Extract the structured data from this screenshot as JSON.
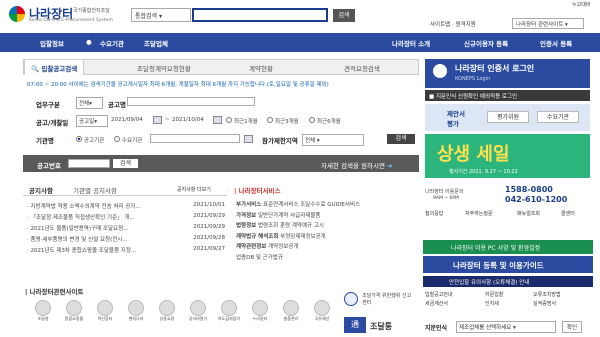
{
  "header": {
    "logo_title": "나라장터",
    "logo_sub1": "국가종합전자조달",
    "logo_sub2": "Korea ON-line E-Procurement System",
    "search_scope": "통합검색",
    "search_button": "검색",
    "top_link": "누고대비",
    "sitemap": "사이트맵 · 원격지원",
    "site_select": "나라장터 관련사이트"
  },
  "nav": {
    "items": [
      "입찰정보",
      "수요기관",
      "조달업체"
    ],
    "right_items": [
      "나라장터 소개",
      "신규이용자 등록",
      "인증서 등록"
    ]
  },
  "tabs": [
    "입찰공고검색",
    "조달청계약요청현황",
    "계약현황",
    "견적요청검색"
  ],
  "search_form": {
    "note": "07:00 ~ 20:00 사이에는 검색기간을 공고게시일자 최대 6개월, 개찰일자 최대 6개월 까지 가능합니다.(토,일요일 및 공휴일 제외)",
    "work_label": "업무구분",
    "work_value": "전체",
    "notice_name_label": "공고명",
    "period_label": "공고/개찰일",
    "period_type": "공고일",
    "date_from": "2021/09/04",
    "date_to": "2021/10/04",
    "range_opts": [
      "최근1개월",
      "최근3개월",
      "최근6개월"
    ],
    "agency_label": "기관명",
    "agency_opts": [
      "공고기관",
      "수요기관"
    ],
    "region_label": "참가제한지역",
    "region_value": "전체",
    "search_btn": "검색",
    "notice_no_label": "공고번호",
    "notice_search_btn": "검색",
    "detail_link": "자세한 검색을 원하시면"
  },
  "news": {
    "tabs": [
      "공지사항",
      "기관별 공지사항"
    ],
    "more": "공지사항 더보기",
    "items": [
      {
        "title": "· 지방계약법 적용 소액수의계약 전송 처리 공지...",
        "date": "2021/10/01"
      },
      {
        "title": "· 「조달청 제조물품 직접생산확인 기준」 개...",
        "date": "2021/09/29"
      },
      {
        "title": "· 2021년도 물품(일반용역)구매 조달요청...",
        "date": "2021/09/29"
      },
      {
        "title": "· 품명·세부품명의 변경 및 신설 요청(전시...",
        "date": "2021/09/28"
      },
      {
        "title": "· 2021년도 제3차 종합쇼핑몰 조달물품 지정...",
        "date": "2021/09/27"
      }
    ]
  },
  "services": {
    "title": "나라장터서비스",
    "rows": [
      [
        "부가서비스",
        "표준연계서비스 조달수수료 GUIDE서비스"
      ],
      [
        "가격정보",
        "일반단가계약 사급자재물품"
      ],
      [
        "법령정보",
        "법령조회 훈령 계약예규 고시"
      ],
      [
        "계약법규 해석조회",
        "부정당제재정보공개"
      ],
      [
        "계약관련정보",
        "계약정보공개"
      ],
      [
        "업종DB 및 근거법규",
        "업종DB 및 근거법규"
      ]
    ]
  },
  "related": {
    "title": "나라장터관련사이트",
    "icons": [
      "조달청",
      "종합쇼핑몰",
      "혁신장터",
      "벤처나라",
      "상용쇼핑",
      "공사비원가",
      "하도급지킴이",
      "누리장터",
      "물품관리",
      "국유재산"
    ]
  },
  "right": {
    "login_title": "나라장터 인증서 로그인",
    "login_sub": "KONEPS Login",
    "fingerprint": "지문인식 신원확인 예외적용 로그인",
    "proposal": "제안서 평가",
    "eval": "평가위원",
    "demand": "수요기관",
    "banner_title": "상생 세일",
    "banner_dates": "행사기간 2021. 9.27 ~ 10.22",
    "callcenter_label": "나라장터 이용문의",
    "call_hours": "9AM ~ 6PM",
    "phone1": "1588-0800",
    "phone2": "042-610-1200",
    "help_links": [
      "질의응답",
      "자주하는질문",
      "매뉴얼조회",
      "콜센터"
    ],
    "pc_check": "나라장터 이용 PC 사양 및 환경설정",
    "register_btn": "나라장터 등록 및 이용가이드",
    "safety": "안전입찰 유의사항 (오류체결) 안내",
    "small_links": [
      "입찰공고안내",
      "지문입찰",
      "오류조치방법",
      "세금계산서",
      "인지세",
      "실적증명서"
    ],
    "finger_label": "지문인식",
    "finger_select": "제조업체를 선택하세요",
    "finger_btn": "확인",
    "mid_banner": "조달가격 위반행위 신고센터",
    "bottom_banner": "조달통"
  }
}
